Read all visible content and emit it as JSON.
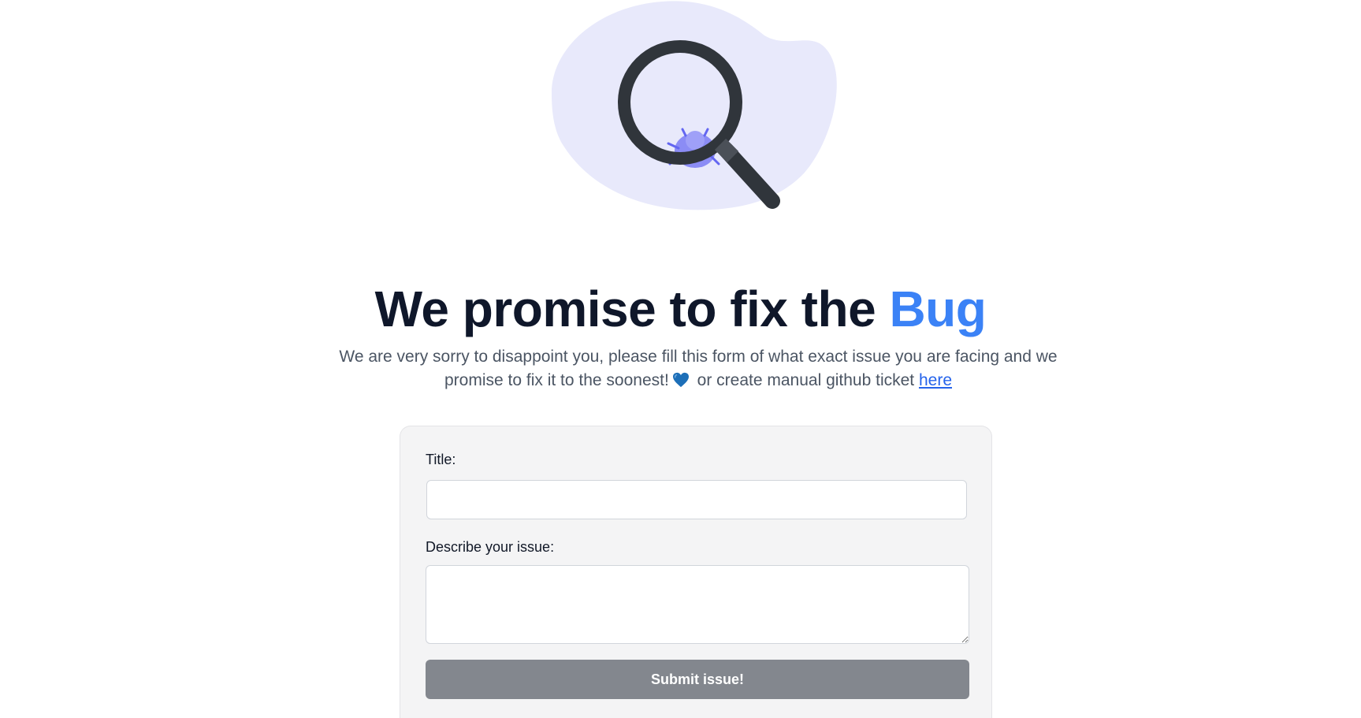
{
  "hero": {
    "title_prefix": "We promise to fix the ",
    "title_accent": "Bug",
    "subtitle_text": "We are very sorry to disappoint you, please fill this form of what exact issue you are facing and we promise to fix it to the soonest!",
    "subtitle_after_icon": " or create manual github ticket ",
    "link_label": "here",
    "heart_icon": "blue-heart-icon"
  },
  "illustration": {
    "icon": "magnifier-bug-icon",
    "blob_color": "#e8e9fb",
    "handle_color": "#30353b",
    "bug_color": "#8b8cf5"
  },
  "form": {
    "title_label": "Title:",
    "title_value": "",
    "description_label": "Describe your issue:",
    "description_value": "",
    "submit_label": "Submit issue!"
  },
  "colors": {
    "accent": "#3b82f6",
    "submit_bg": "#83878e",
    "card_bg": "#f4f4f5"
  }
}
